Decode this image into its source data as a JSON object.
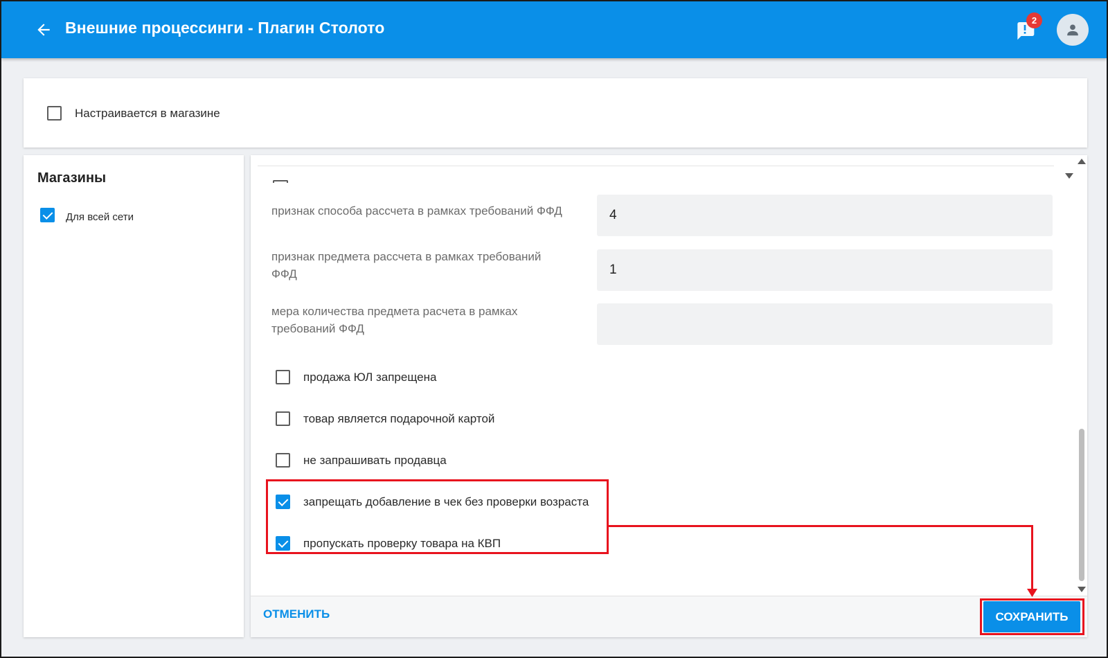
{
  "header": {
    "back_icon": "arrow-left-icon",
    "title": "Внешние процессинги - Плагин Столото",
    "notification_icon": "chat-alert-icon",
    "notification_count": "2",
    "avatar_icon": "user-icon"
  },
  "store_config": {
    "label": "Настраивается в магазине",
    "checked": false
  },
  "stores": {
    "title": "Магазины",
    "items": [
      {
        "label": "Для всей сети",
        "checked": true
      }
    ]
  },
  "fields": [
    {
      "label": "признак способа рассчета в рамках требований ФФД",
      "value": "4"
    },
    {
      "label": "признак предмета рассчета в рамках требований ФФД",
      "value": "1"
    },
    {
      "label": "мера количества предмета расчета в рамках требований ФФД",
      "value": ""
    }
  ],
  "options": [
    {
      "label": "продажа ЮЛ запрещена",
      "checked": false
    },
    {
      "label": "товар является подарочной картой",
      "checked": false
    },
    {
      "label": "не запрашивать продавца",
      "checked": false
    },
    {
      "label": "запрещать добавление в чек без проверки возраста",
      "checked": true
    },
    {
      "label": "пропускать проверку товара на КВП",
      "checked": true
    }
  ],
  "footer": {
    "cancel_label": "ОТМЕНИТЬ",
    "save_label": "СОХРАНИТЬ"
  },
  "colors": {
    "primary": "#0a8fe8",
    "highlight": "#e8131e",
    "badge": "#e53935"
  }
}
